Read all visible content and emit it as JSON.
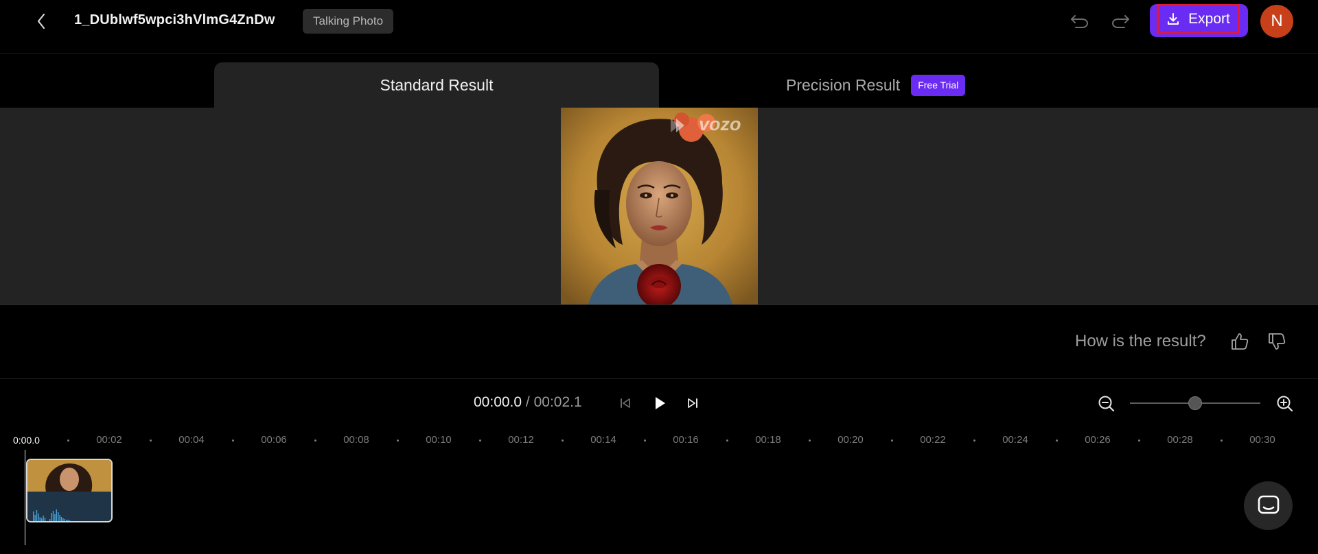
{
  "header": {
    "back_icon": "chevron-left-icon",
    "title": "1_DUblwf5wpci3hVlmG4ZnDw",
    "mode_tag": "Talking Photo",
    "undo_icon": "undo-icon",
    "redo_icon": "redo-icon",
    "export_label": "Export",
    "export_icon": "download-icon",
    "avatar_initial": "N"
  },
  "tabs": [
    {
      "label": "Standard Result",
      "active": true
    },
    {
      "label": "Precision Result",
      "active": false,
      "badge": "Free Trial"
    }
  ],
  "preview": {
    "watermark": "vozo"
  },
  "feedback": {
    "question": "How is the result?",
    "up_icon": "thumbs-up-icon",
    "down_icon": "thumbs-down-icon"
  },
  "playback": {
    "current_time": "00:00.0",
    "separator": "/",
    "total_time": "00:02.1"
  },
  "zoom": {
    "level": 0.5
  },
  "timeline": {
    "current_marker": "0:00.0",
    "ticks": [
      "00:02",
      "00:04",
      "00:06",
      "00:08",
      "00:10",
      "00:12",
      "00:14",
      "00:16",
      "00:18",
      "00:20",
      "00:22",
      "00:24",
      "00:26",
      "00:28",
      "00:30"
    ]
  },
  "colors": {
    "accent": "#6a2bf2",
    "export_outline": "#e11936",
    "avatar": "#c8401a",
    "panel": "#232323"
  }
}
